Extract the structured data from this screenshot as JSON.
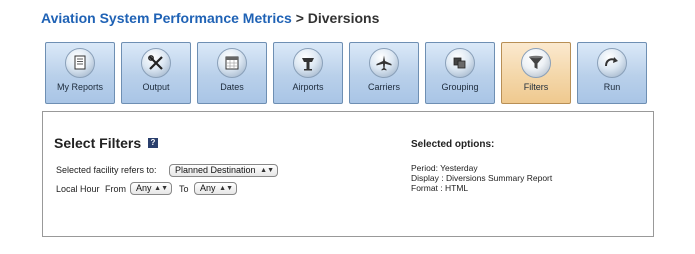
{
  "breadcrumb": {
    "link": "Aviation System Performance Metrics",
    "separator": ">",
    "current": "Diversions"
  },
  "tabs": [
    {
      "label": "My Reports",
      "icon": "report-icon"
    },
    {
      "label": "Output",
      "icon": "tools-icon"
    },
    {
      "label": "Dates",
      "icon": "calendar-icon"
    },
    {
      "label": "Airports",
      "icon": "control-tower-icon"
    },
    {
      "label": "Carriers",
      "icon": "airplane-icon"
    },
    {
      "label": "Grouping",
      "icon": "grouping-icon"
    },
    {
      "label": "Filters",
      "icon": "funnel-icon",
      "active": true
    },
    {
      "label": "Run",
      "icon": "run-arrow-icon"
    }
  ],
  "colors": {
    "breadcrumb_link": "#1f62b5",
    "tab_bg": "#b9d0ea",
    "active_tab_bg": "#f4d7a9",
    "help_badge": "#2a3f6d"
  },
  "filters": {
    "title": "Select Filters",
    "help_label": "?",
    "facility_label": "Selected facility refers to:",
    "facility_value": "Planned Destination",
    "local_hour_label": "Local Hour",
    "from_label": "From",
    "from_value": "Any",
    "to_label": "To",
    "to_value": "Any",
    "select_arrows": "▲▼"
  },
  "selected_options": {
    "title": "Selected options:",
    "lines": [
      "Period: Yesterday",
      "Display : Diversions Summary Report",
      "Format : HTML"
    ]
  }
}
